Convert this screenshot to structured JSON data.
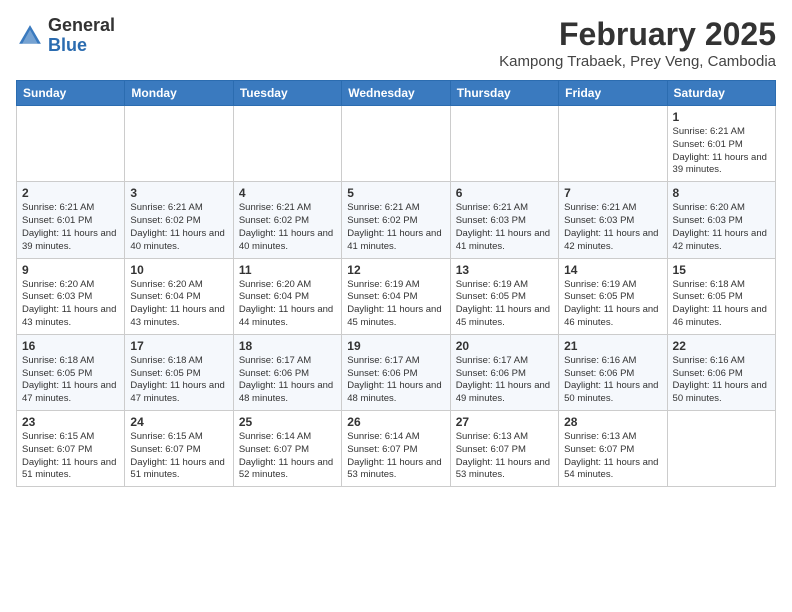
{
  "header": {
    "logo_general": "General",
    "logo_blue": "Blue",
    "month_year": "February 2025",
    "location": "Kampong Trabaek, Prey Veng, Cambodia"
  },
  "weekdays": [
    "Sunday",
    "Monday",
    "Tuesday",
    "Wednesday",
    "Thursday",
    "Friday",
    "Saturday"
  ],
  "weeks": [
    [
      {
        "day": "",
        "info": ""
      },
      {
        "day": "",
        "info": ""
      },
      {
        "day": "",
        "info": ""
      },
      {
        "day": "",
        "info": ""
      },
      {
        "day": "",
        "info": ""
      },
      {
        "day": "",
        "info": ""
      },
      {
        "day": "1",
        "info": "Sunrise: 6:21 AM\nSunset: 6:01 PM\nDaylight: 11 hours and 39 minutes."
      }
    ],
    [
      {
        "day": "2",
        "info": "Sunrise: 6:21 AM\nSunset: 6:01 PM\nDaylight: 11 hours and 39 minutes."
      },
      {
        "day": "3",
        "info": "Sunrise: 6:21 AM\nSunset: 6:02 PM\nDaylight: 11 hours and 40 minutes."
      },
      {
        "day": "4",
        "info": "Sunrise: 6:21 AM\nSunset: 6:02 PM\nDaylight: 11 hours and 40 minutes."
      },
      {
        "day": "5",
        "info": "Sunrise: 6:21 AM\nSunset: 6:02 PM\nDaylight: 11 hours and 41 minutes."
      },
      {
        "day": "6",
        "info": "Sunrise: 6:21 AM\nSunset: 6:03 PM\nDaylight: 11 hours and 41 minutes."
      },
      {
        "day": "7",
        "info": "Sunrise: 6:21 AM\nSunset: 6:03 PM\nDaylight: 11 hours and 42 minutes."
      },
      {
        "day": "8",
        "info": "Sunrise: 6:20 AM\nSunset: 6:03 PM\nDaylight: 11 hours and 42 minutes."
      }
    ],
    [
      {
        "day": "9",
        "info": "Sunrise: 6:20 AM\nSunset: 6:03 PM\nDaylight: 11 hours and 43 minutes."
      },
      {
        "day": "10",
        "info": "Sunrise: 6:20 AM\nSunset: 6:04 PM\nDaylight: 11 hours and 43 minutes."
      },
      {
        "day": "11",
        "info": "Sunrise: 6:20 AM\nSunset: 6:04 PM\nDaylight: 11 hours and 44 minutes."
      },
      {
        "day": "12",
        "info": "Sunrise: 6:19 AM\nSunset: 6:04 PM\nDaylight: 11 hours and 45 minutes."
      },
      {
        "day": "13",
        "info": "Sunrise: 6:19 AM\nSunset: 6:05 PM\nDaylight: 11 hours and 45 minutes."
      },
      {
        "day": "14",
        "info": "Sunrise: 6:19 AM\nSunset: 6:05 PM\nDaylight: 11 hours and 46 minutes."
      },
      {
        "day": "15",
        "info": "Sunrise: 6:18 AM\nSunset: 6:05 PM\nDaylight: 11 hours and 46 minutes."
      }
    ],
    [
      {
        "day": "16",
        "info": "Sunrise: 6:18 AM\nSunset: 6:05 PM\nDaylight: 11 hours and 47 minutes."
      },
      {
        "day": "17",
        "info": "Sunrise: 6:18 AM\nSunset: 6:05 PM\nDaylight: 11 hours and 47 minutes."
      },
      {
        "day": "18",
        "info": "Sunrise: 6:17 AM\nSunset: 6:06 PM\nDaylight: 11 hours and 48 minutes."
      },
      {
        "day": "19",
        "info": "Sunrise: 6:17 AM\nSunset: 6:06 PM\nDaylight: 11 hours and 48 minutes."
      },
      {
        "day": "20",
        "info": "Sunrise: 6:17 AM\nSunset: 6:06 PM\nDaylight: 11 hours and 49 minutes."
      },
      {
        "day": "21",
        "info": "Sunrise: 6:16 AM\nSunset: 6:06 PM\nDaylight: 11 hours and 50 minutes."
      },
      {
        "day": "22",
        "info": "Sunrise: 6:16 AM\nSunset: 6:06 PM\nDaylight: 11 hours and 50 minutes."
      }
    ],
    [
      {
        "day": "23",
        "info": "Sunrise: 6:15 AM\nSunset: 6:07 PM\nDaylight: 11 hours and 51 minutes."
      },
      {
        "day": "24",
        "info": "Sunrise: 6:15 AM\nSunset: 6:07 PM\nDaylight: 11 hours and 51 minutes."
      },
      {
        "day": "25",
        "info": "Sunrise: 6:14 AM\nSunset: 6:07 PM\nDaylight: 11 hours and 52 minutes."
      },
      {
        "day": "26",
        "info": "Sunrise: 6:14 AM\nSunset: 6:07 PM\nDaylight: 11 hours and 53 minutes."
      },
      {
        "day": "27",
        "info": "Sunrise: 6:13 AM\nSunset: 6:07 PM\nDaylight: 11 hours and 53 minutes."
      },
      {
        "day": "28",
        "info": "Sunrise: 6:13 AM\nSunset: 6:07 PM\nDaylight: 11 hours and 54 minutes."
      },
      {
        "day": "",
        "info": ""
      }
    ]
  ]
}
